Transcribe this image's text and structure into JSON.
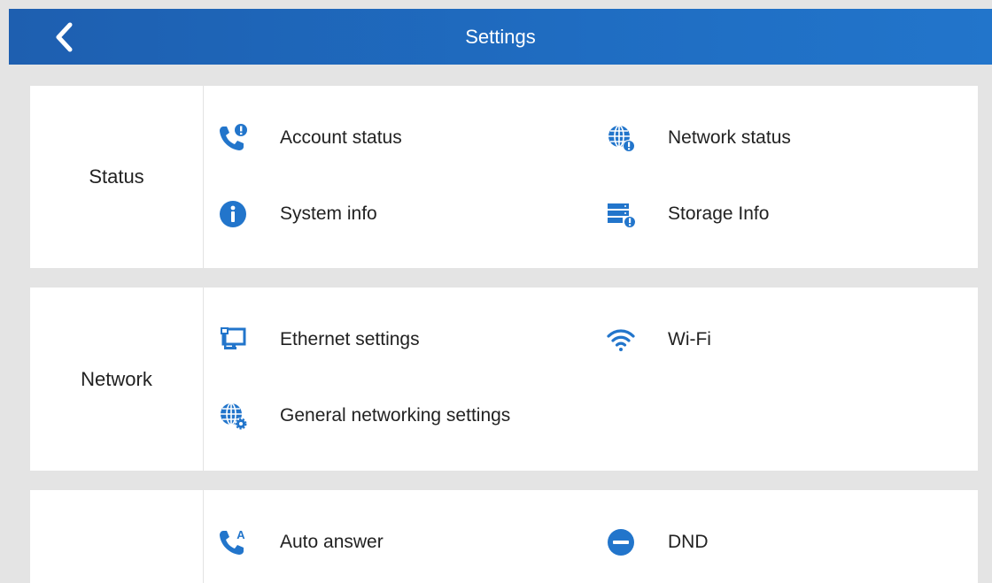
{
  "header": {
    "title": "Settings",
    "back_icon": "chevron-left-icon"
  },
  "accent_color": "#2275cb",
  "sections": {
    "status": {
      "label": "Status",
      "items": {
        "account_status": {
          "label": "Account status",
          "icon": "phone-alert-icon"
        },
        "network_status": {
          "label": "Network status",
          "icon": "globe-alert-icon"
        },
        "system_info": {
          "label": "System info",
          "icon": "info-icon"
        },
        "storage_info": {
          "label": "Storage Info",
          "icon": "storage-alert-icon"
        }
      }
    },
    "network": {
      "label": "Network",
      "items": {
        "ethernet_settings": {
          "label": "Ethernet settings",
          "icon": "ethernet-icon"
        },
        "wifi": {
          "label": "Wi-Fi",
          "icon": "wifi-icon"
        },
        "general_networking": {
          "label": "General networking settings",
          "icon": "globe-gear-icon"
        }
      }
    },
    "call": {
      "label": "",
      "items": {
        "auto_answer": {
          "label": "Auto answer",
          "icon": "phone-auto-answer-icon"
        },
        "dnd": {
          "label": "DND",
          "icon": "dnd-icon"
        }
      }
    }
  }
}
